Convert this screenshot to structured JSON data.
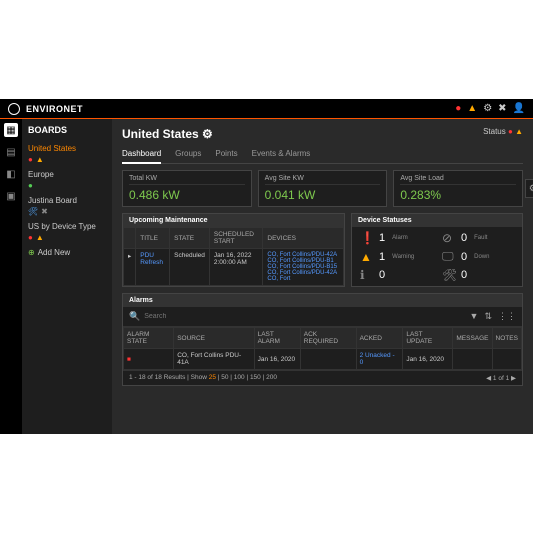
{
  "brand": "ENVIRONET",
  "topicons": [
    "●",
    "▲",
    "⚙",
    "✖",
    "👤"
  ],
  "boards": {
    "title": "BOARDS",
    "items": [
      {
        "label": "United States",
        "active": true,
        "icons": [
          "🔴",
          "⚠"
        ]
      },
      {
        "label": "Europe",
        "icons": [
          "🟢"
        ]
      },
      {
        "label": "Justina Board",
        "icons": [
          "🛠",
          "✖"
        ]
      },
      {
        "label": "US by Device Type",
        "icons": [
          "🔴",
          "⚠"
        ]
      }
    ],
    "add": "Add New"
  },
  "page": {
    "title": "United States ⚙",
    "status": "Status",
    "tabs": [
      "Dashboard",
      "Groups",
      "Points",
      "Events & Alarms"
    ]
  },
  "kpis": [
    {
      "label": "Total KW",
      "value": "0.486 kW"
    },
    {
      "label": "Avg Site KW",
      "value": "0.041 kW"
    },
    {
      "label": "Avg Site Load",
      "value": "0.283%"
    }
  ],
  "maint": {
    "title": "Upcoming Maintenance",
    "headers": [
      "",
      "TITLE",
      "STATE",
      "SCHEDULED START",
      "DEVICES"
    ],
    "row": {
      "title": "PDU Refresh",
      "state": "Scheduled",
      "start": "Jan 16, 2022 2:00:00 AM",
      "devices": "CO, Fort Collins/PDU-42A  CO, Fort Collins/PDU-B1  CO, Fort Collins/PDU-B15  CO, Fort Collins/PDU-42A  CO, Fort"
    }
  },
  "dev": {
    "title": "Device Statuses",
    "items": [
      {
        "icon": "❗",
        "cls": "red",
        "val": "1",
        "lbl": "Alarm"
      },
      {
        "icon": "⊘",
        "cls": "gray",
        "val": "0",
        "lbl": "Fault"
      },
      {
        "icon": "▲",
        "cls": "yel",
        "val": "1",
        "lbl": "Warning"
      },
      {
        "icon": "🖵",
        "cls": "gray",
        "val": "0",
        "lbl": "Down"
      },
      {
        "icon": "ℹ",
        "cls": "gray",
        "val": "0",
        "lbl": ""
      },
      {
        "icon": "🛠",
        "cls": "gray",
        "val": "0",
        "lbl": ""
      }
    ]
  },
  "alarms": {
    "title": "Alarms",
    "search": "Search",
    "headers": [
      "ALARM STATE",
      "SOURCE",
      "LAST ALARM",
      "ACK REQUIRED",
      "ACKED",
      "LAST UPDATE",
      "MESSAGE",
      "NOTES"
    ],
    "row": {
      "state": "🟥",
      "source": "CO, Fort Collins PDU-41A",
      "last": "Jan 16, 2020",
      "ack": "",
      "acked": "2 Unacked - 0",
      "update": "Jan 16, 2020",
      "msg": "",
      "notes": ""
    },
    "pager": {
      "left": "1 - 18 of 18 Results | Show ",
      "opts": "25 | 50 | 100 | 150 | 200",
      "right": "◀ 1 of 1 ▶"
    }
  }
}
